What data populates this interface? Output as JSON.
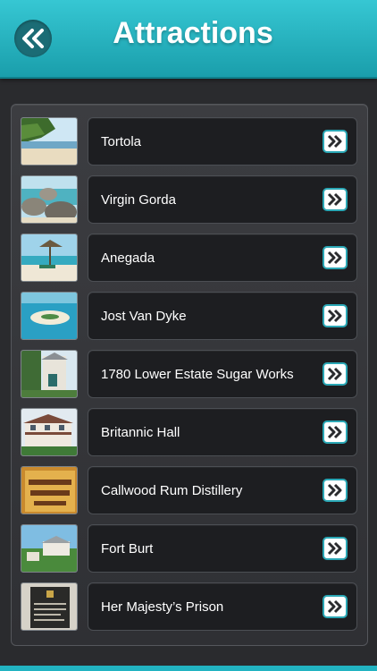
{
  "header": {
    "title": "Attractions",
    "back_icon": "double-chevron-left-icon"
  },
  "list": {
    "item_arrow_icon": "double-chevron-right-icon",
    "items": [
      {
        "label": "Tortola"
      },
      {
        "label": "Virgin Gorda"
      },
      {
        "label": "Anegada"
      },
      {
        "label": "Jost Van Dyke"
      },
      {
        "label": "1780 Lower Estate Sugar Works"
      },
      {
        "label": "Britannic Hall"
      },
      {
        "label": "Callwood Rum Distillery"
      },
      {
        "label": "Fort Burt"
      },
      {
        "label": "Her Majesty’s Prison"
      }
    ]
  },
  "colors": {
    "accent": "#22b3c1",
    "background": "#2a2b2e"
  }
}
